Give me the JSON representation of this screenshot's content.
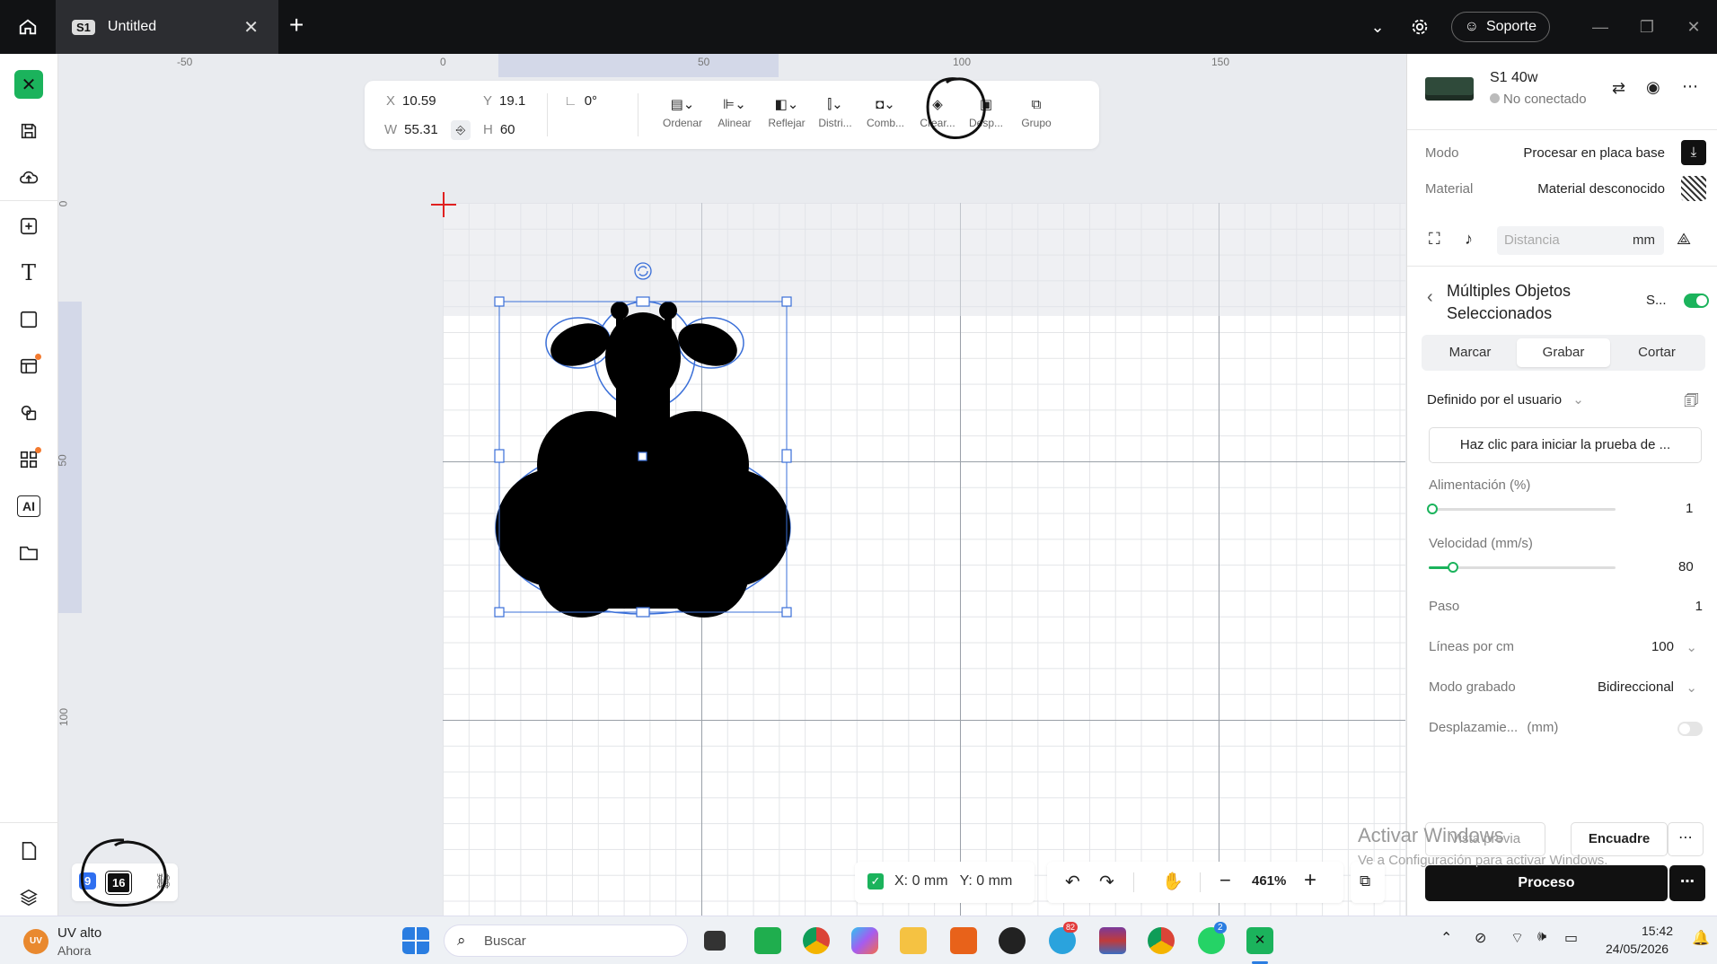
{
  "titlebar": {
    "tab_badge": "S1",
    "tab_title": "Untitled",
    "support_label": "Soporte"
  },
  "ruler": {
    "top_labels": [
      "-50",
      "0",
      "50",
      "100",
      "150"
    ],
    "left_labels": [
      "0",
      "50",
      "100"
    ]
  },
  "toolbar": {
    "x_label": "X",
    "x_value": "10.59",
    "y_label": "Y",
    "y_value": "19.1",
    "w_label": "W",
    "w_value": "55.31",
    "h_label": "H",
    "h_value": "60",
    "angle_value": "0°",
    "tools": [
      "Ordenar",
      "Alinear",
      "Reflejar",
      "Distri...",
      "Comb...",
      "Crear...",
      "Desp...",
      "Grupo"
    ]
  },
  "device": {
    "name": "S1 40w",
    "status": "No conectado"
  },
  "settings": {
    "mode_label": "Modo",
    "mode_value": "Procesar en placa base",
    "material_label": "Material",
    "material_value": "Material desconocido",
    "distance_placeholder": "Distancia",
    "distance_unit": "mm"
  },
  "selection": {
    "title": "Múltiples Objetos Seleccionados",
    "short_label": "S...",
    "toggle_on": true,
    "tabs": [
      "Marcar",
      "Grabar",
      "Cortar"
    ],
    "active_tab": "Grabar",
    "preset": "Definido por el usuario",
    "test_button": "Haz clic para iniciar la prueba de ..."
  },
  "params": {
    "power_label": "Alimentación (%)",
    "power_value": "1",
    "power_fraction": 0.01,
    "speed_label": "Velocidad (mm/s)",
    "speed_value": "80",
    "speed_fraction": 0.12,
    "pass_label": "Paso",
    "pass_value": "1",
    "lines_label": "Líneas por cm",
    "lines_value": "100",
    "engrave_mode_label": "Modo grabado",
    "engrave_mode_value": "Bidireccional",
    "offset_label": "Desplazamie...",
    "offset_unit": "(mm)",
    "offset_toggle_on": false
  },
  "actions": {
    "preview": "Vista previa",
    "frame": "Encuadre",
    "process": "Proceso"
  },
  "status": {
    "coords": "X: 0 mm   Y: 0 mm",
    "zoom": "461%",
    "layer_badge_1": "9",
    "layer_badge_2": "16"
  },
  "watermark": {
    "line1": "Activar Windows",
    "line2": "Ve a Configuración para activar Windows."
  },
  "taskbar": {
    "weather_title": "UV alto",
    "weather_sub": "Ahora",
    "weather_badge": "UV",
    "search_placeholder": "Buscar",
    "time": "15:42",
    "date": "24/05/2026",
    "telegram_badge": "82",
    "whatsapp_badge": "2"
  },
  "colors": {
    "accent": "#1bb35c",
    "selection_blue": "#3a6fd8",
    "titlebar": "#111214"
  }
}
